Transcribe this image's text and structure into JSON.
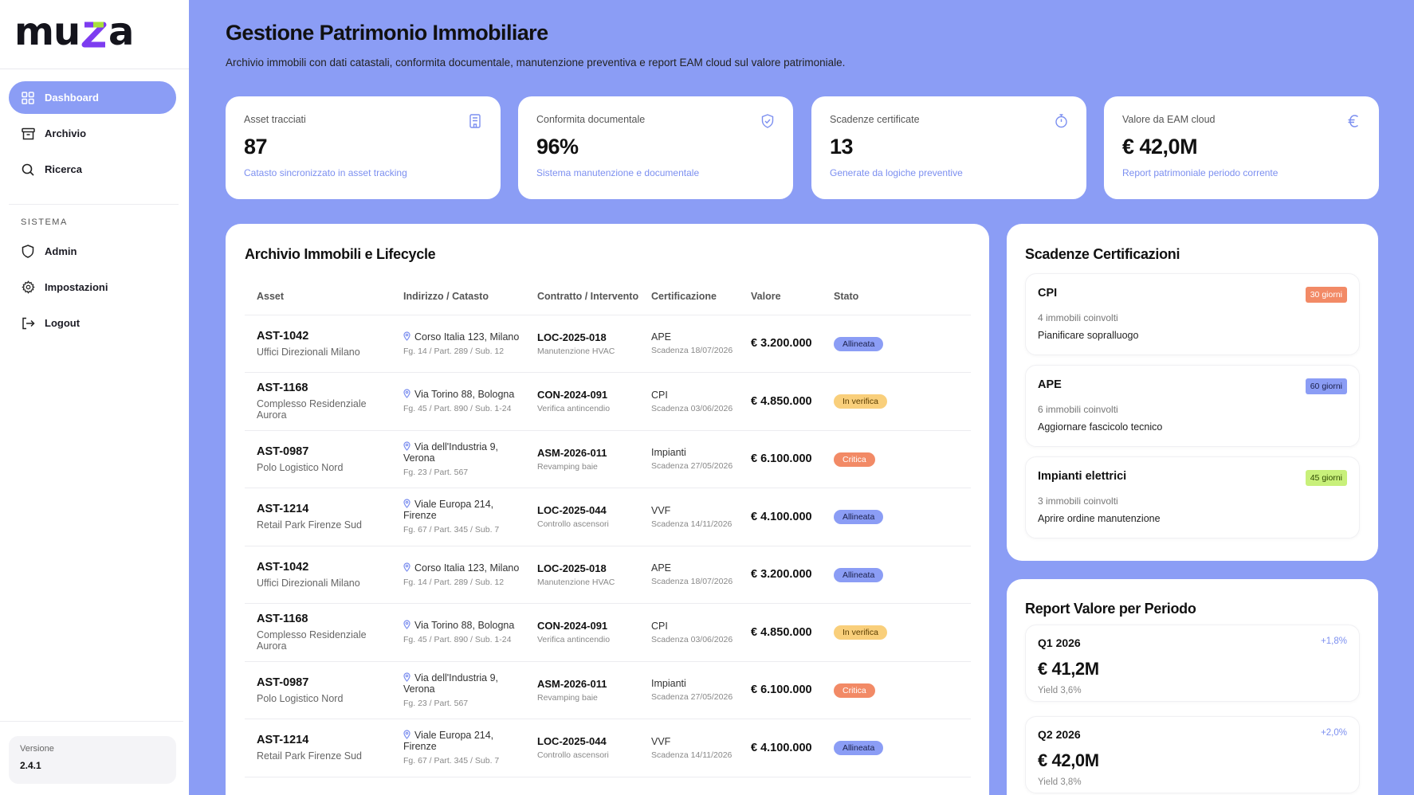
{
  "colors": {
    "accent": "#8b9df5",
    "accent_text": "#7c8ff0",
    "critical": "#f28a66",
    "warning": "#f9cf7b",
    "success": "#c8f07a"
  },
  "brand": {
    "name": "muza"
  },
  "sidebar": {
    "items": [
      {
        "label": "Dashboard",
        "icon": "grid-icon",
        "active": true
      },
      {
        "label": "Archivio",
        "icon": "archive-box-icon"
      },
      {
        "label": "Ricerca",
        "icon": "search-icon"
      }
    ],
    "section_label": "SISTEMA",
    "system_items": [
      {
        "label": "Admin",
        "icon": "shield-icon"
      },
      {
        "label": "Impostazioni",
        "icon": "gear-icon"
      },
      {
        "label": "Logout",
        "icon": "logout-icon"
      }
    ],
    "version_label": "Versione",
    "version_value": "2.4.1"
  },
  "header": {
    "title": "Gestione Patrimonio Immobiliare",
    "subtitle": "Archivio immobili con dati catastali, conformita documentale, manutenzione preventiva e report EAM cloud sul valore patrimoniale."
  },
  "kpis": [
    {
      "label": "Asset tracciati",
      "value": "87",
      "note": "Catasto sincronizzato in asset tracking",
      "icon": "building-icon"
    },
    {
      "label": "Conformita documentale",
      "value": "96%",
      "note": "Sistema manutenzione e documentale",
      "icon": "shield-check-icon"
    },
    {
      "label": "Scadenze certificate",
      "value": "13",
      "note": "Generate da logiche preventive",
      "icon": "timer-icon"
    },
    {
      "label": "Valore da EAM cloud",
      "value": "€ 42,0M",
      "note": "Report patrimoniale periodo corrente",
      "icon": "euro-icon"
    }
  ],
  "archive": {
    "title": "Archivio Immobili e Lifecycle",
    "columns": [
      "Asset",
      "Indirizzo / Catasto",
      "Contratto / Intervento",
      "Certificazione",
      "Valore",
      "Stato"
    ],
    "rows": [
      {
        "id": "AST-1042",
        "name": "Uffici Direzionali Milano",
        "address": "Corso Italia 123, Milano",
        "cadastre": "Fg. 14 / Part. 289 / Sub. 12",
        "contract": "LOC-2025-018",
        "intervention": "Manutenzione HVAC",
        "cert": "APE",
        "cert_due": "Scadenza 18/07/2026",
        "value": "€ 3.200.000",
        "status": "Allineata",
        "status_kind": "ok"
      },
      {
        "id": "AST-1168",
        "name": "Complesso Residenziale Aurora",
        "address": "Via Torino 88, Bologna",
        "cadastre": "Fg. 45 / Part. 890 / Sub. 1-24",
        "contract": "CON-2024-091",
        "intervention": "Verifica antincendio",
        "cert": "CPI",
        "cert_due": "Scadenza 03/06/2026",
        "value": "€ 4.850.000",
        "status": "In verifica",
        "status_kind": "ver"
      },
      {
        "id": "AST-0987",
        "name": "Polo Logistico Nord",
        "address": "Via dell'Industria 9, Verona",
        "cadastre": "Fg. 23 / Part. 567",
        "contract": "ASM-2026-011",
        "intervention": "Revamping baie",
        "cert": "Impianti",
        "cert_due": "Scadenza 27/05/2026",
        "value": "€ 6.100.000",
        "status": "Critica",
        "status_kind": "crit"
      },
      {
        "id": "AST-1214",
        "name": "Retail Park Firenze Sud",
        "address": "Viale Europa 214, Firenze",
        "cadastre": "Fg. 67 / Part. 345 / Sub. 7",
        "contract": "LOC-2025-044",
        "intervention": "Controllo ascensori",
        "cert": "VVF",
        "cert_due": "Scadenza 14/11/2026",
        "value": "€ 4.100.000",
        "status": "Allineata",
        "status_kind": "ok"
      },
      {
        "id": "AST-1042",
        "name": "Uffici Direzionali Milano",
        "address": "Corso Italia 123, Milano",
        "cadastre": "Fg. 14 / Part. 289 / Sub. 12",
        "contract": "LOC-2025-018",
        "intervention": "Manutenzione HVAC",
        "cert": "APE",
        "cert_due": "Scadenza 18/07/2026",
        "value": "€ 3.200.000",
        "status": "Allineata",
        "status_kind": "ok"
      },
      {
        "id": "AST-1168",
        "name": "Complesso Residenziale Aurora",
        "address": "Via Torino 88, Bologna",
        "cadastre": "Fg. 45 / Part. 890 / Sub. 1-24",
        "contract": "CON-2024-091",
        "intervention": "Verifica antincendio",
        "cert": "CPI",
        "cert_due": "Scadenza 03/06/2026",
        "value": "€ 4.850.000",
        "status": "In verifica",
        "status_kind": "ver"
      },
      {
        "id": "AST-0987",
        "name": "Polo Logistico Nord",
        "address": "Via dell'Industria 9, Verona",
        "cadastre": "Fg. 23 / Part. 567",
        "contract": "ASM-2026-011",
        "intervention": "Revamping baie",
        "cert": "Impianti",
        "cert_due": "Scadenza 27/05/2026",
        "value": "€ 6.100.000",
        "status": "Critica",
        "status_kind": "crit"
      },
      {
        "id": "AST-1214",
        "name": "Retail Park Firenze Sud",
        "address": "Viale Europa 214, Firenze",
        "cadastre": "Fg. 67 / Part. 345 / Sub. 7",
        "contract": "LOC-2025-044",
        "intervention": "Controllo ascensori",
        "cert": "VVF",
        "cert_due": "Scadenza 14/11/2026",
        "value": "€ 4.100.000",
        "status": "Allineata",
        "status_kind": "ok"
      }
    ]
  },
  "deadlines": {
    "title": "Scadenze Certificazioni",
    "items": [
      {
        "title": "CPI",
        "tag": "30 giorni",
        "tag_kind": "or",
        "count": "4 immobili coinvolti",
        "action": "Pianificare sopralluogo"
      },
      {
        "title": "APE",
        "tag": "60 giorni",
        "tag_kind": "bl",
        "count": "6 immobili coinvolti",
        "action": "Aggiornare fascicolo tecnico"
      },
      {
        "title": "Impianti elettrici",
        "tag": "45 giorni",
        "tag_kind": "gr",
        "count": "3 immobili coinvolti",
        "action": "Aprire ordine manutenzione"
      }
    ]
  },
  "report": {
    "title": "Report Valore per Periodo",
    "periods": [
      {
        "period": "Q1 2026",
        "value": "€ 41,2M",
        "yield": "Yield 3,6%",
        "delta": "+1,8%"
      },
      {
        "period": "Q2 2026",
        "value": "€ 42,0M",
        "yield": "Yield 3,8%",
        "delta": "+2,0%"
      }
    ]
  }
}
